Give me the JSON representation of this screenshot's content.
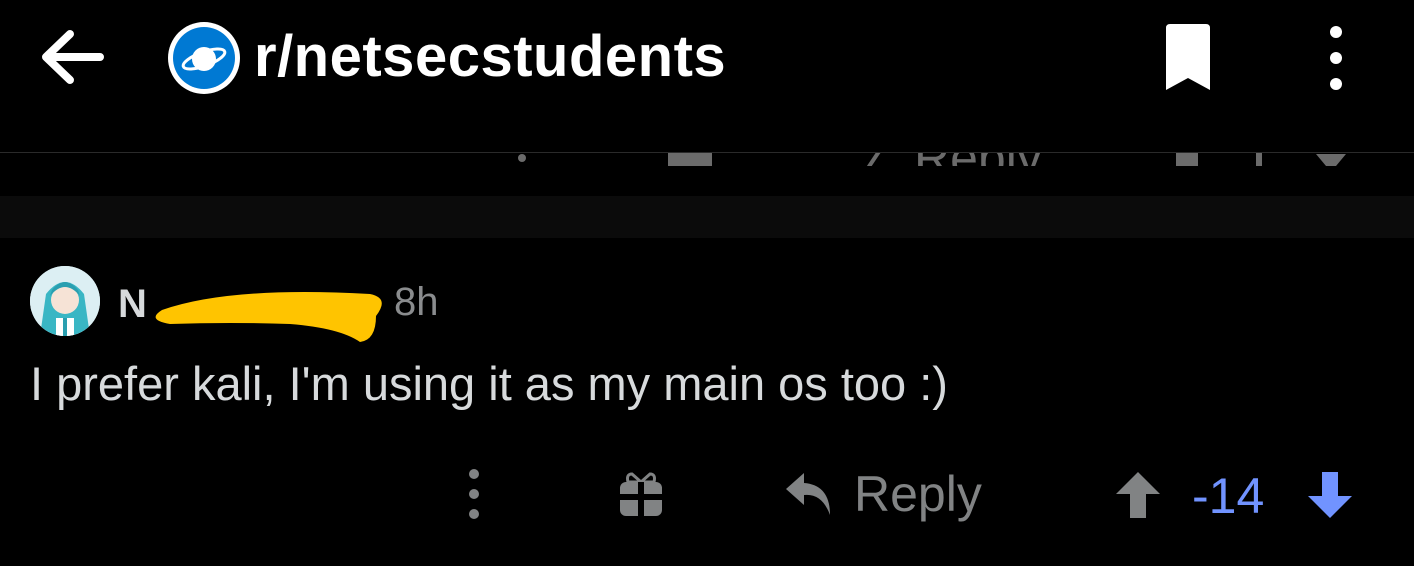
{
  "header": {
    "subreddit": "r/netsecstudents",
    "icons": [
      "back-arrow-icon",
      "subreddit-planet-icon",
      "bookmark-icon",
      "more-vertical-icon"
    ]
  },
  "previous_comment": {
    "reply_label": "Reply"
  },
  "comment": {
    "username": "N",
    "time": "8h",
    "body": "I prefer kali, I'm using it as my main os too :)",
    "reply_label": "Reply",
    "score": "-14",
    "score_color": "#7193ff",
    "icons": [
      "more-vertical-icon",
      "gift-icon",
      "reply-arrow-icon",
      "upvote-icon",
      "downvote-icon"
    ]
  },
  "colors": {
    "background": "#000000",
    "text": "#d7dadc",
    "muted": "#818384",
    "accent_blue": "#0079d3",
    "redaction": "#ffc400"
  }
}
